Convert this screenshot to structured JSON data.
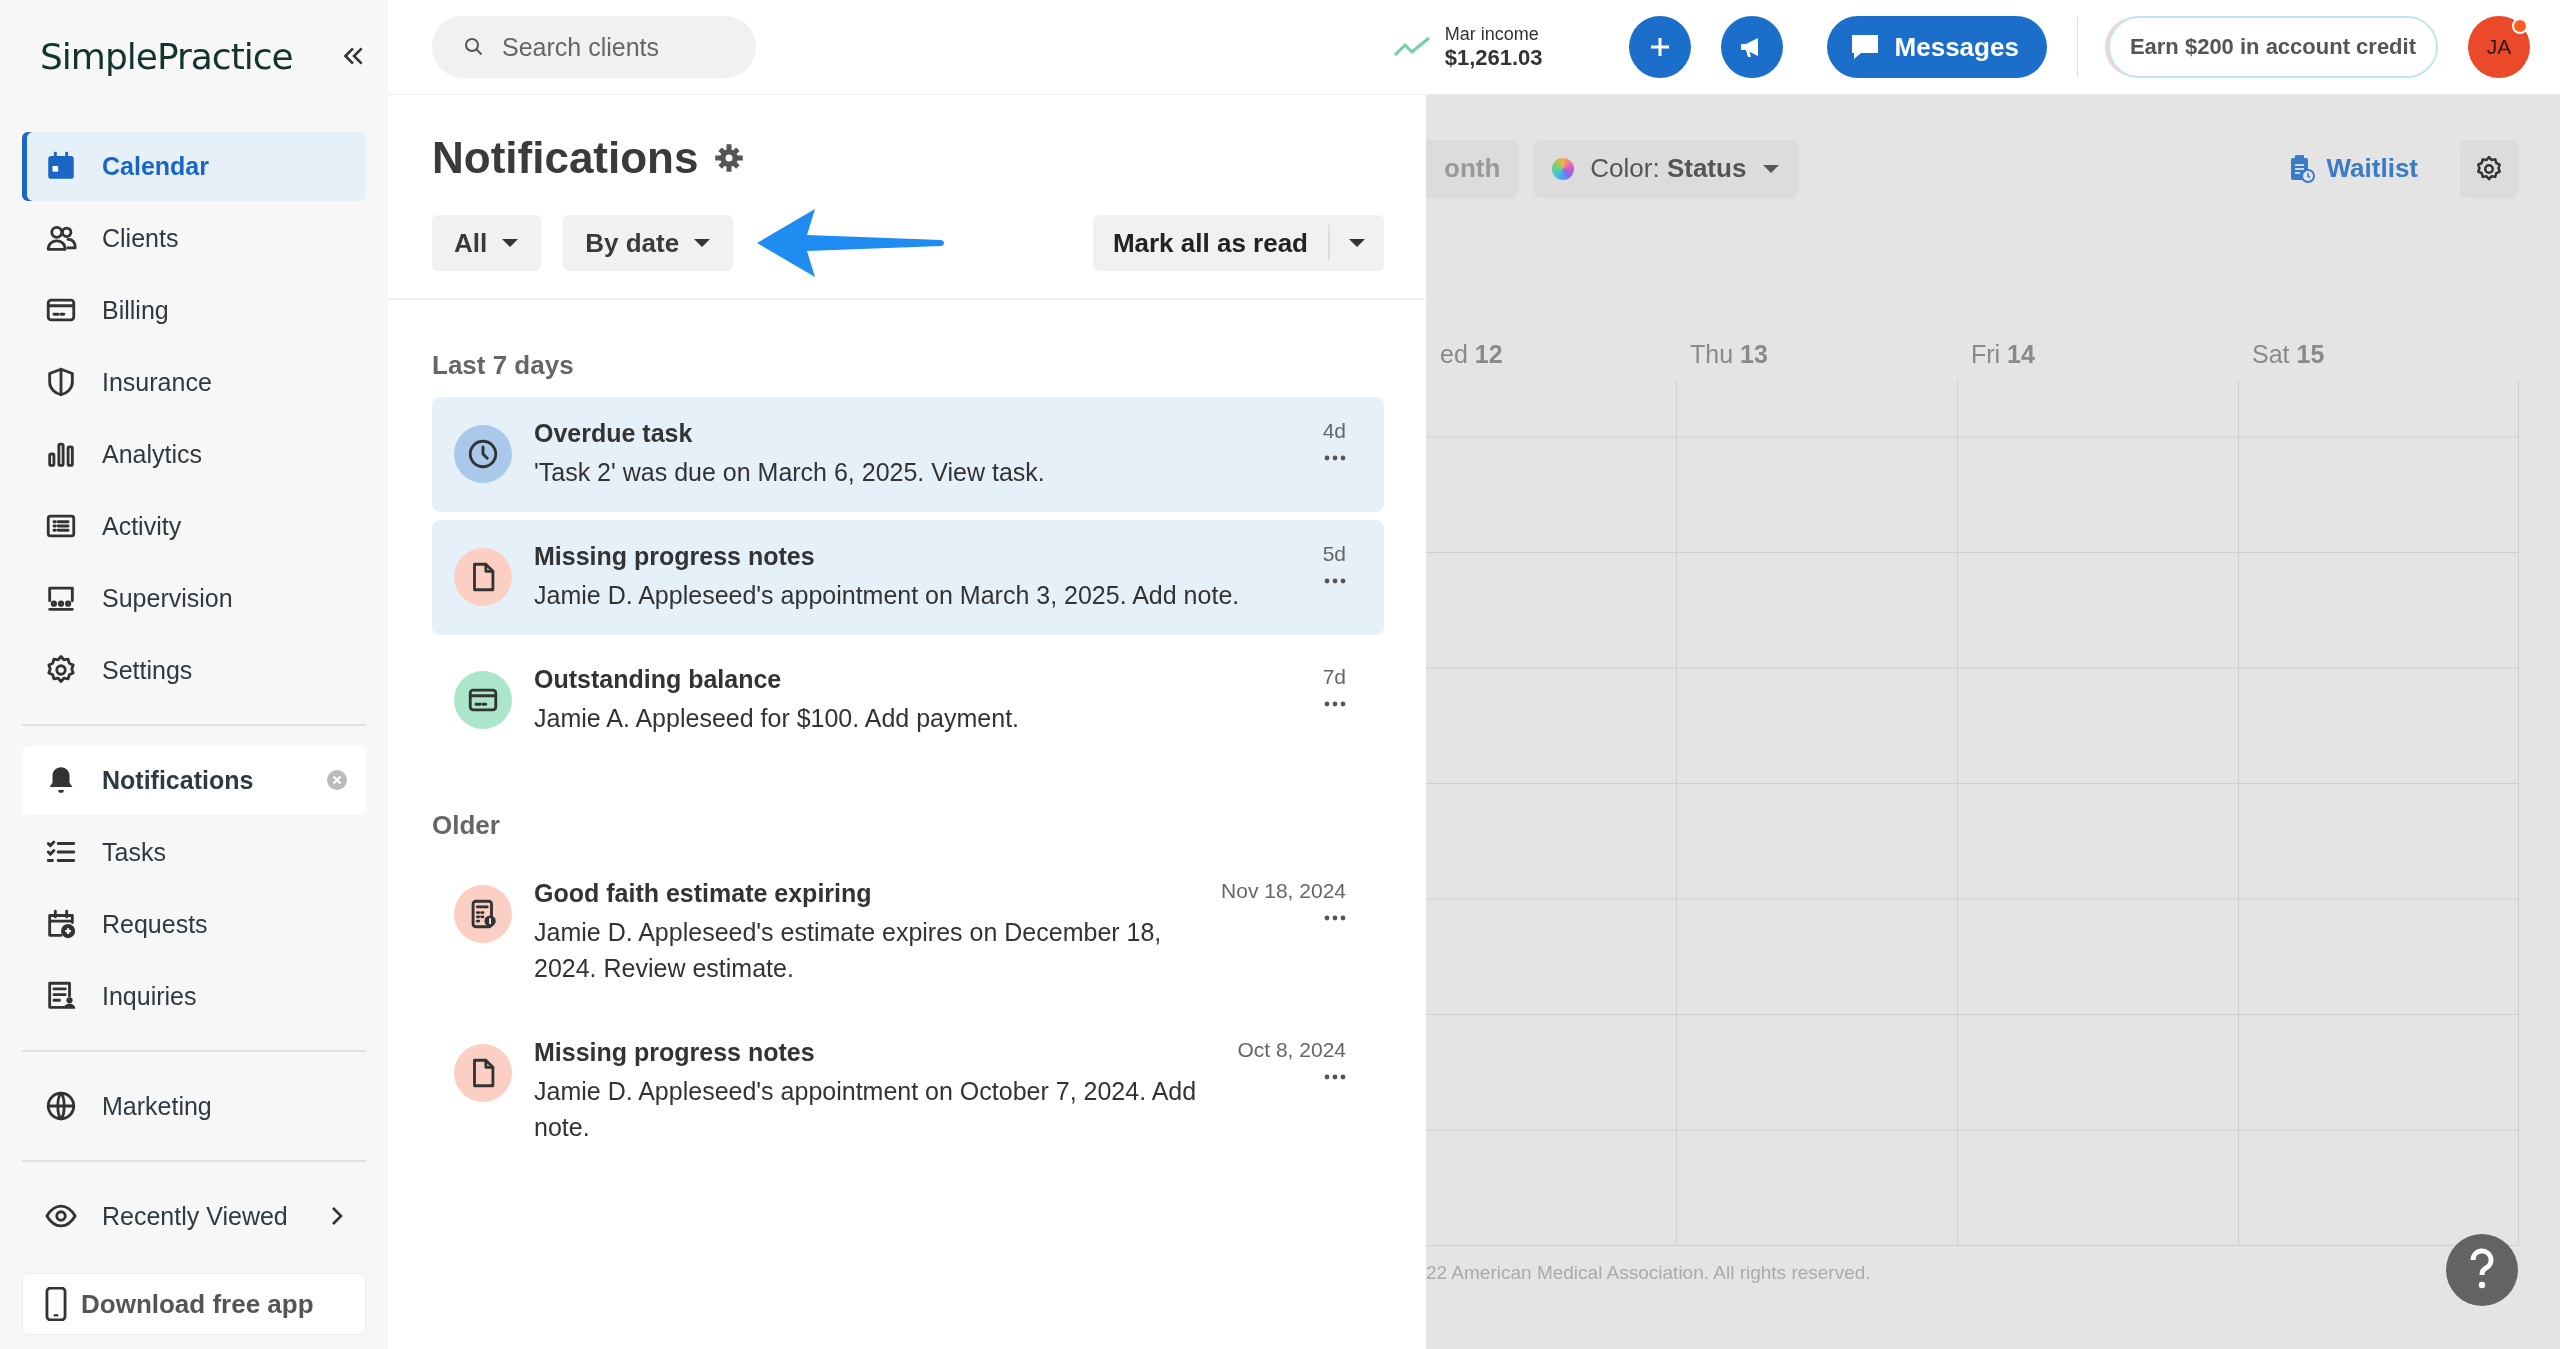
{
  "sidebar": {
    "logo": "SimplePractice",
    "groups": [
      {
        "items": [
          {
            "label": "Calendar",
            "kind": "link",
            "selected": true,
            "open": false
          },
          {
            "label": "Clients",
            "kind": "link",
            "selected": false,
            "open": false
          },
          {
            "label": "Billing",
            "kind": "link",
            "selected": false,
            "open": false
          },
          {
            "label": "Insurance",
            "kind": "link",
            "selected": false,
            "open": false
          },
          {
            "label": "Analytics",
            "kind": "link",
            "selected": false,
            "open": false
          },
          {
            "label": "Activity",
            "kind": "link",
            "selected": false,
            "open": false
          },
          {
            "label": "Supervision",
            "kind": "link",
            "selected": false,
            "open": false
          },
          {
            "label": "Settings",
            "kind": "link",
            "selected": false,
            "open": false
          }
        ]
      },
      {
        "items": [
          {
            "label": "Notifications",
            "kind": "link",
            "selected": false,
            "open": true
          },
          {
            "label": "Tasks",
            "kind": "link",
            "selected": false,
            "open": false
          },
          {
            "label": "Requests",
            "kind": "link",
            "selected": false,
            "open": false
          },
          {
            "label": "Inquiries",
            "kind": "link",
            "selected": false,
            "open": false
          }
        ]
      },
      {
        "items": [
          {
            "label": "Marketing",
            "kind": "link",
            "selected": false,
            "open": false
          }
        ]
      },
      {
        "items": [
          {
            "label": "Recently Viewed",
            "kind": "submenu",
            "selected": false,
            "open": false
          }
        ]
      }
    ],
    "download_app": "Download free app"
  },
  "header": {
    "search": {
      "placeholder": "Search clients"
    },
    "income": {
      "label": "Mar income",
      "amount": "$1,261.03"
    },
    "messages_button": "Messages",
    "credit_button": "Earn $200 in account credit",
    "avatar": {
      "initials": "JA",
      "alert": true
    }
  },
  "notifications": {
    "title": "Notifications",
    "filters": [
      {
        "label": "All"
      },
      {
        "label": "By date"
      }
    ],
    "mark_all": "Mark all as read",
    "sections": [
      {
        "heading": "Last 7 days",
        "items": [
          {
            "kind": "task",
            "title": "Overdue task",
            "body": "'Task 2' was due on March 6, 2025. View task.",
            "time": "4d",
            "unread": true
          },
          {
            "kind": "note",
            "title": "Missing progress notes",
            "body": "Jamie D. Appleseed's appointment on March 3, 2025. Add note.",
            "time": "5d",
            "unread": true
          },
          {
            "kind": "payment",
            "title": "Outstanding balance",
            "body": "Jamie A. Appleseed for $100. Add payment.",
            "time": "7d",
            "unread": false
          }
        ]
      },
      {
        "heading": "Older",
        "items": [
          {
            "kind": "estimate",
            "title": "Good faith estimate expiring",
            "body": "Jamie D. Appleseed's estimate expires on December 18, 2024. Review estimate.",
            "time": "Nov 18, 2024",
            "unread": false
          },
          {
            "kind": "note",
            "title": "Missing progress notes",
            "body": "Jamie D. Appleseed's appointment on October 7, 2024. Add note.",
            "time": "Oct 8, 2024",
            "unread": false
          }
        ]
      }
    ]
  },
  "calendar": {
    "view_button": "onth",
    "color_button": "Color: **Status**",
    "waitlist": "Waitlist",
    "days": [
      "ed **12**",
      "Thu **13**",
      "Fri **14**",
      "Sat **15**"
    ],
    "footer": "22 American Medical Association. All rights reserved."
  }
}
